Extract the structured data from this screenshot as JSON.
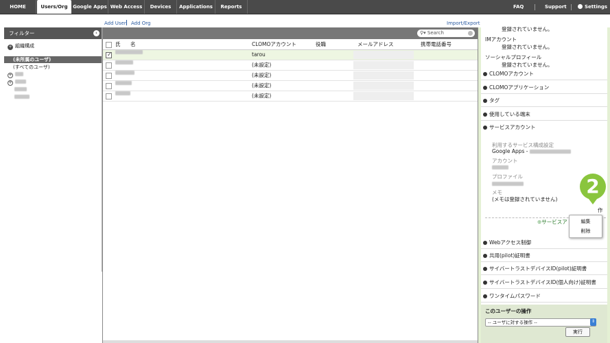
{
  "nav": {
    "tabs": [
      "HOME",
      "Users/Org",
      "Google Apps",
      "Web Access",
      "Devices",
      "Applications",
      "Reports"
    ],
    "right": {
      "faq": "FAQ",
      "support": "Support",
      "settings": "Settings"
    }
  },
  "links": {
    "add_user": "Add User",
    "add_org": "Add Org",
    "import_export": "Import/Export"
  },
  "filter": {
    "title": "フィルター",
    "org_tree": "組織構成",
    "unassigned": "(未所属のユーザ)",
    "all_users": "(すべてのユーザ)"
  },
  "grid": {
    "search_placeholder": "Search",
    "columns": {
      "last": "氏",
      "first": "名",
      "clomo": "CLOMOアカウント",
      "title": "役職",
      "email": "メールアドレス",
      "phone": "携帯電話番号"
    },
    "rows": [
      {
        "clomo": "tarou"
      },
      {
        "clomo": "(未設定)"
      },
      {
        "clomo": "(未設定)"
      },
      {
        "clomo": "(未設定)"
      },
      {
        "clomo": "(未設定)"
      }
    ]
  },
  "detail": {
    "top_lines": [
      "登録されていません。",
      "IMアカウント",
      "登録されていません。",
      "ソーシャルプロフィール",
      "登録されていません。"
    ],
    "sections": [
      "CLOMOアカウント",
      "CLOMOアプリケーション",
      "タグ",
      "使用している端末",
      "サービスアカウント"
    ],
    "service": {
      "config_label": "利用するサービス構成設定",
      "config_value": "Google Apps -",
      "account_label": "アカウント",
      "profile_label": "プロファイル",
      "memo_label": "メモ",
      "memo_value": "(メモは登録されていません)",
      "ops_fragment": "作",
      "add_fragment": "サービスア"
    },
    "sections2": [
      "Webアクセス制御",
      "共用(pilot)証明書",
      "サイバートラストデバイスID(pilot)証明書",
      "サイバートラストデバイスID(個人向け)証明書",
      "ワンタイムパスワード"
    ],
    "user_ops": {
      "title": "このユーザーの操作",
      "select_value": "-- ユーザに対する操作 --",
      "exec": "実行"
    }
  },
  "popup": {
    "edit": "編集",
    "delete": "削除"
  },
  "step_badge": "2"
}
